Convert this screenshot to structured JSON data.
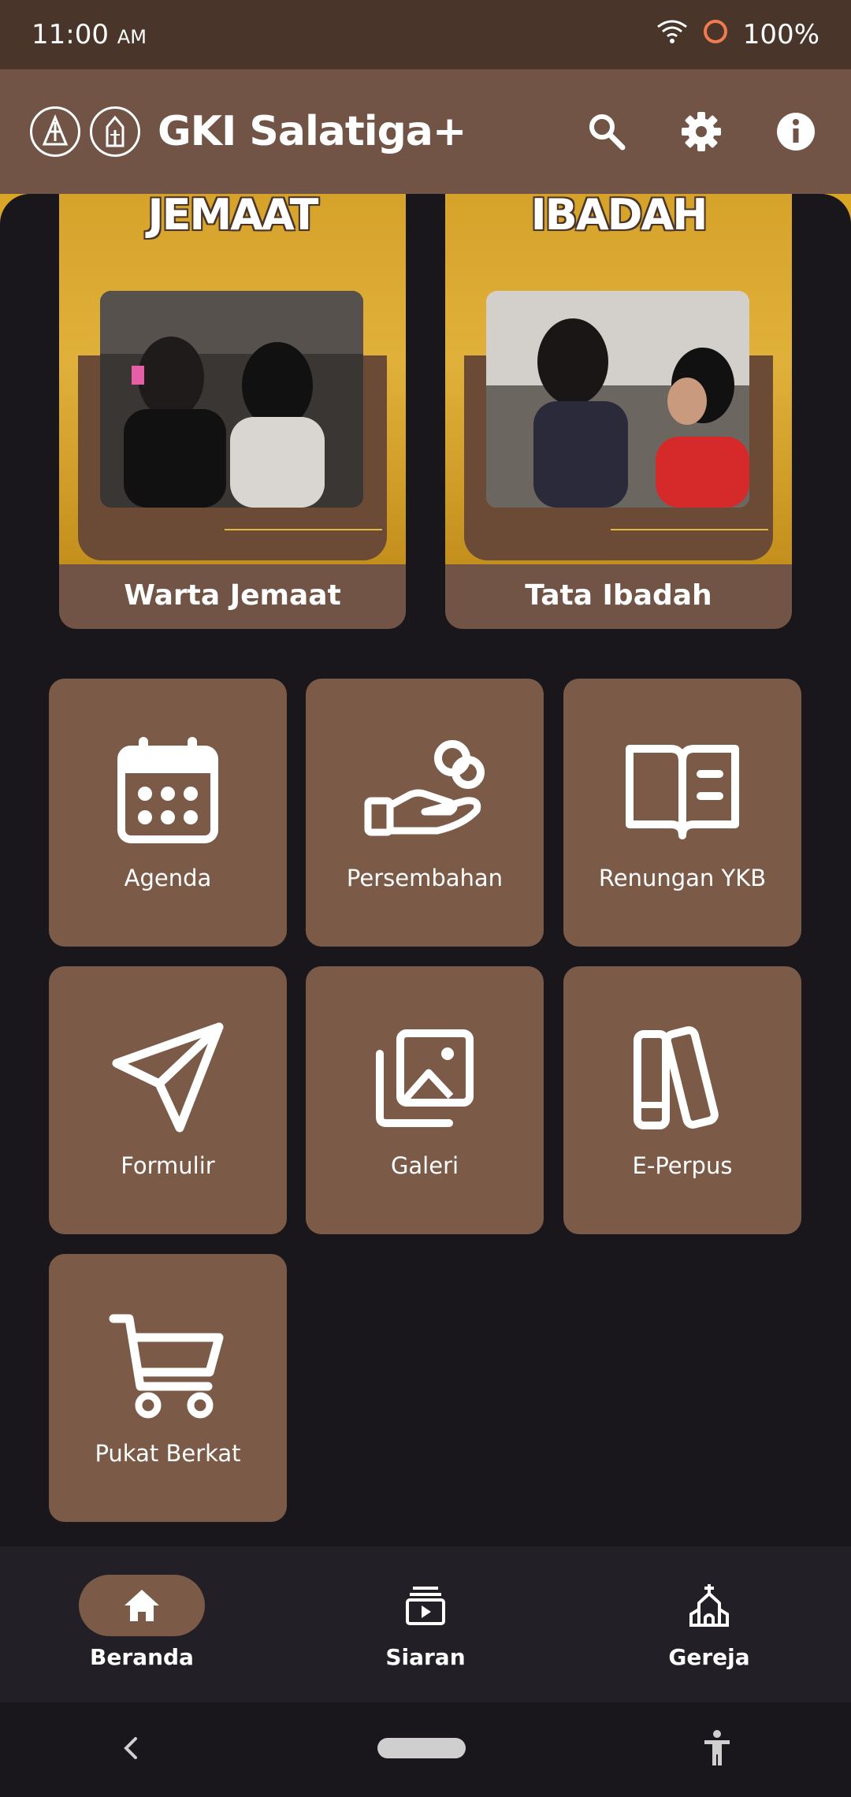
{
  "status": {
    "time": "11:00",
    "ampm": "AM",
    "battery": "100%"
  },
  "appbar": {
    "title": "GKI Salatiga+"
  },
  "banners": [
    {
      "word": "JEMAAT",
      "label": "Warta Jemaat"
    },
    {
      "word": "IBADAH",
      "label": "Tata Ibadah"
    }
  ],
  "menu": [
    {
      "label": "Agenda",
      "icon": "calendar-icon"
    },
    {
      "label": "Persembahan",
      "icon": "offering-hand-icon"
    },
    {
      "label": "Renungan YKB",
      "icon": "open-book-icon"
    },
    {
      "label": "Formulir",
      "icon": "send-icon"
    },
    {
      "label": "Galeri",
      "icon": "gallery-icon"
    },
    {
      "label": "E-Perpus",
      "icon": "books-icon"
    },
    {
      "label": "Pukat Berkat",
      "icon": "cart-icon"
    }
  ],
  "nav": [
    {
      "label": "Beranda",
      "icon": "home-icon",
      "active": true
    },
    {
      "label": "Siaran",
      "icon": "broadcast-icon",
      "active": false
    },
    {
      "label": "Gereja",
      "icon": "church-icon",
      "active": false
    }
  ],
  "colors": {
    "appbar": "#725446",
    "tile": "#7b5a48",
    "background": "#1a171c",
    "accent": "#e0b13a"
  }
}
